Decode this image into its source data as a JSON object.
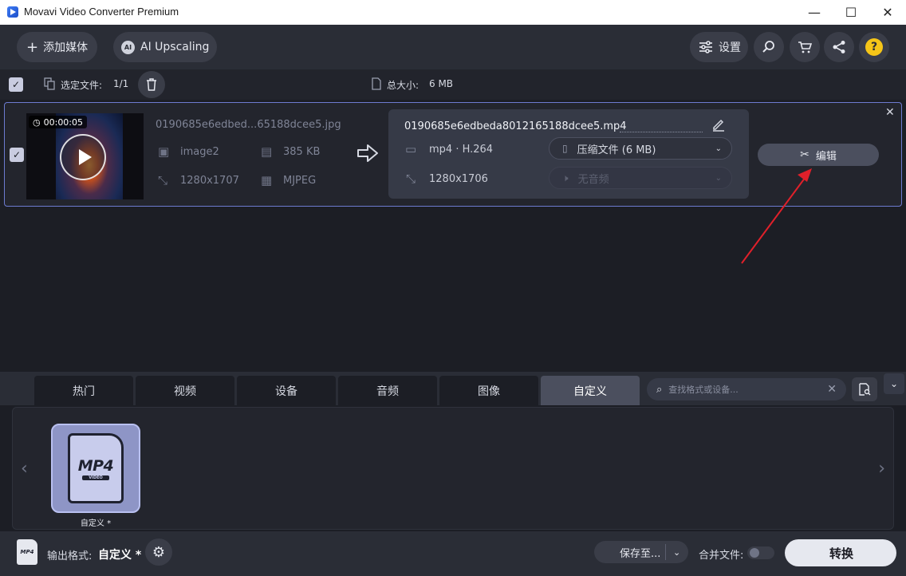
{
  "window": {
    "title": "Movavi Video Converter Premium",
    "minimize": "—",
    "maximize": "☐",
    "close": "✕"
  },
  "toolbar": {
    "add_media": "添加媒体",
    "ai_upscaling": "AI Upscaling",
    "settings": "设置"
  },
  "selection": {
    "label": "选定文件:",
    "count": "1/1",
    "total_size_label": "总大小:",
    "total_size": "6 MB"
  },
  "file": {
    "duration": "00:00:05",
    "input_name": "0190685e6edbed...65188dcee5.jpg",
    "codec": "image2",
    "size": "385 KB",
    "resolution": "1280x1707",
    "format": "MJPEG",
    "output_name": "0190685e6edbeda8012165188dcee5.mp4",
    "output_format": "mp4 · H.264",
    "output_resolution": "1280x1706",
    "compress_label": "压缩文件 (6 MB)",
    "audio_label": "无音频",
    "edit_label": "编辑"
  },
  "tabs": [
    {
      "label": "热门"
    },
    {
      "label": "视频"
    },
    {
      "label": "设备"
    },
    {
      "label": "音频"
    },
    {
      "label": "图像"
    },
    {
      "label": "自定义"
    }
  ],
  "search": {
    "placeholder": "查找格式或设备..."
  },
  "formats": [
    {
      "label": "自定义 *",
      "badge": "MP4",
      "sub": "VIDEO"
    }
  ],
  "bottom": {
    "output_format_label": "输出格式:",
    "output_format_value": "自定义 *",
    "save_to": "保存至...",
    "merge_label": "合并文件:",
    "convert": "转换",
    "badge_mini": "MP4"
  },
  "colors": {
    "accent": "#6d7bd0",
    "arrow": "#e0202a"
  }
}
